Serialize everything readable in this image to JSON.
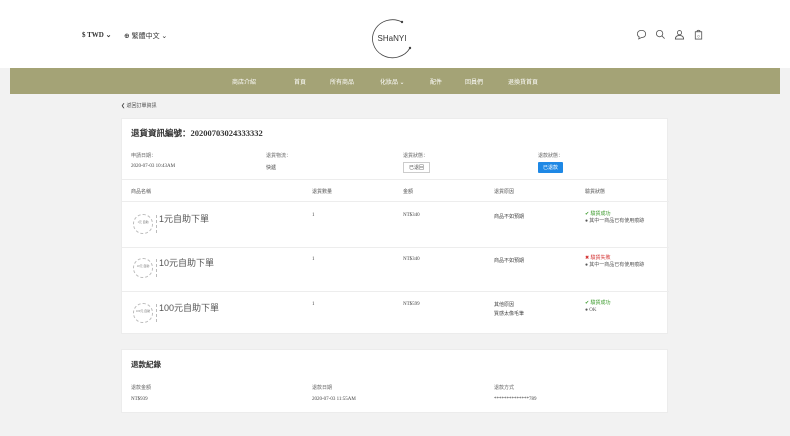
{
  "header": {
    "currency": "$ TWD",
    "language": "繁體中文",
    "logo": "SHaNYI",
    "icons": [
      "chat-icon",
      "search-icon",
      "user-icon",
      "cart-icon"
    ]
  },
  "nav": [
    "商店介紹",
    "首頁",
    "所有商品",
    "化妝品",
    "配件",
    "回員們",
    "退換貨首頁"
  ],
  "back_link": "返回訂單資訊",
  "return_info": {
    "title": "退貨資訊編號：20200703024333332",
    "apply_date_label": "申請日期：",
    "apply_date": "2020-07-03 10:43AM",
    "logistics_label": "退貨物流：",
    "logistics": "快遞",
    "return_status_label": "退貨狀態：",
    "return_status": "已退回",
    "refund_status_label": "退款狀態：",
    "refund_status": "已退款"
  },
  "table": {
    "headers": [
      "商品名稱",
      "退貨數量",
      "金額",
      "退貨原因",
      "驗貨狀態"
    ],
    "rows": [
      {
        "thumb": "1元 自助",
        "name": "1元自助下單",
        "qty": "1",
        "amount": "NT$340",
        "reason": "商品不如預期",
        "reason2": "",
        "status": "驗貨成功",
        "status_type": "ok",
        "note": "其中一商品已有使用痕跡"
      },
      {
        "thumb": "10元 自助",
        "name": "10元自助下單",
        "qty": "1",
        "amount": "NT$340",
        "reason": "商品不如預期",
        "reason2": "",
        "status": "驗貨失敗",
        "status_type": "fail",
        "note": "其中一商品已有使用痕跡"
      },
      {
        "thumb": "100元 自助",
        "name": "100元自助下單",
        "qty": "1",
        "amount": "NT$599",
        "reason": "其他原因",
        "reason2": "質感太像毛筆",
        "status": "驗貨成功",
        "status_type": "ok",
        "note": "OK"
      }
    ]
  },
  "refund": {
    "title": "退款紀錄",
    "amount_label": "退款金額",
    "amount": "NT$939",
    "date_label": "退款日期",
    "date": "2020-07-03 11:55AM",
    "method_label": "退款方式",
    "method": "**************789"
  }
}
